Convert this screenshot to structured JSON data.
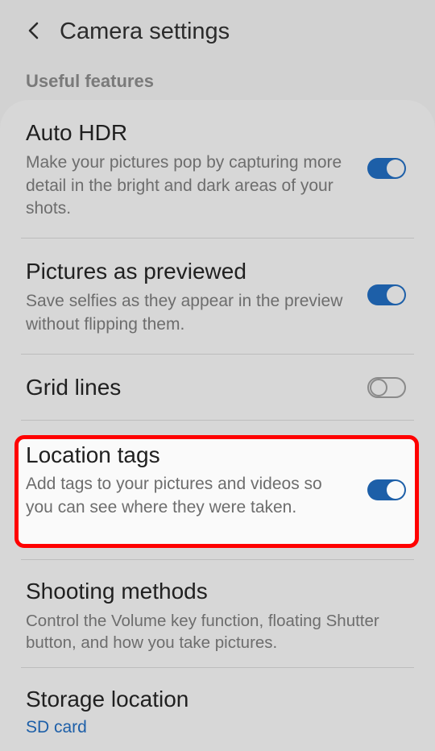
{
  "header": {
    "back_icon": "chevron-left-icon",
    "title": "Camera settings"
  },
  "section": {
    "label": "Useful features"
  },
  "items": [
    {
      "title": "Auto HDR",
      "description": "Make your pictures pop by capturing more detail in the bright and dark areas of your shots.",
      "toggle": "on"
    },
    {
      "title": "Pictures as previewed",
      "description": "Save selfies as they appear in the preview without flipping them.",
      "toggle": "on"
    },
    {
      "title": "Grid lines",
      "toggle": "off"
    },
    {
      "title": "Location tags",
      "description": "Add tags to your pictures and videos so you can see where they were taken.",
      "toggle": "on"
    },
    {
      "title": "Shooting methods",
      "description": "Control the Volume key function, floating Shutter button, and how you take pictures."
    },
    {
      "title": "Storage location",
      "value": "SD card"
    }
  ],
  "colors": {
    "accent": "#1d5fa8",
    "highlight_border": "#ff0000"
  }
}
